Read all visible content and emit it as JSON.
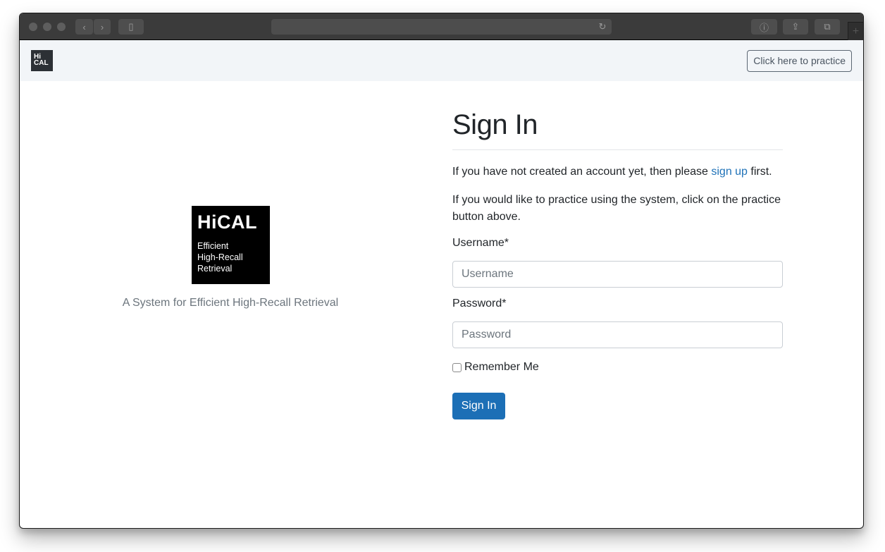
{
  "browser": {
    "traffic_lights": [
      "close",
      "minimize",
      "zoom"
    ],
    "icons": {
      "back": "‹",
      "forward": "›",
      "sidebar": "▯",
      "reload": "↻",
      "info": "ⓘ",
      "share": "⇪",
      "tabs": "⧉",
      "new_tab": "+"
    }
  },
  "navbar": {
    "logo_line1": "Hi",
    "logo_line2": "CAL",
    "practice_button": "Click here to practice"
  },
  "hero": {
    "logo_title": "HiCAL",
    "logo_line1": "Efficient",
    "logo_line2": "High-Recall",
    "logo_line3": "Retrieval",
    "tagline": "A System for Efficient High-Recall Retrieval"
  },
  "signin": {
    "title": "Sign In",
    "para1_before": "If you have not created an account yet, then please ",
    "para1_link": "sign up",
    "para1_after": " first.",
    "para2": "If you would like to practice using the system, click on the practice button above.",
    "username_label": "Username*",
    "username_placeholder": "Username",
    "username_value": "",
    "password_label": "Password*",
    "password_placeholder": "Password",
    "password_value": "",
    "remember_label": "Remember Me",
    "remember_checked": false,
    "submit_label": "Sign In"
  },
  "colors": {
    "primary": "#1c6fb6",
    "link": "#1f72b8",
    "navbar_bg": "#f2f5f8",
    "muted_text": "#6c757d"
  }
}
